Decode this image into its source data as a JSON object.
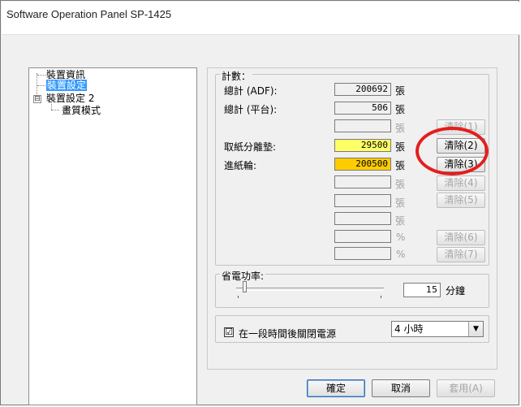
{
  "window": {
    "title": "Software Operation Panel SP-1425"
  },
  "tree": {
    "items": [
      {
        "label": "裝置資訊"
      },
      {
        "label": "裝置設定"
      },
      {
        "label": "裝置設定 2",
        "expander": "⊟"
      },
      {
        "label": "畫質模式"
      }
    ]
  },
  "counters": {
    "group_title": "計數：",
    "rows": [
      {
        "label": "總計 (ADF):",
        "value": "200692",
        "unit": "張"
      },
      {
        "label": "總計 (平台):",
        "value": "506",
        "unit": "張"
      },
      {
        "label": "",
        "value": "",
        "unit": "張",
        "button": "清除(1)"
      },
      {
        "label": "取紙分離墊:",
        "value": "29500",
        "unit": "張",
        "button": "清除(2)"
      },
      {
        "label": "進紙輪:",
        "value": "200500",
        "unit": "張",
        "button": "清除(3)"
      },
      {
        "label": "",
        "value": "",
        "unit": "張",
        "button": "清除(4)"
      },
      {
        "label": "",
        "value": "",
        "unit": "張",
        "button": "清除(5)"
      },
      {
        "label": "",
        "value": "",
        "unit": "張"
      },
      {
        "label": "",
        "value": "",
        "unit": "%",
        "button": "清除(6)"
      },
      {
        "label": "",
        "value": "",
        "unit": "%",
        "button": "清除(7)"
      }
    ],
    "colors": {
      "yellow": "#ffff66",
      "orange": "#ffcc00",
      "highlight_ring": "#e41e1e"
    }
  },
  "power_saving": {
    "group_title": "省電功率:",
    "value": "15",
    "unit": "分鐘"
  },
  "auto_power_off": {
    "checkbox_mark": "☑",
    "label": "在一段時間後關閉電源",
    "selected": "4 小時"
  },
  "footer": {
    "ok": "確定",
    "cancel": "取消",
    "apply": "套用(A)"
  }
}
